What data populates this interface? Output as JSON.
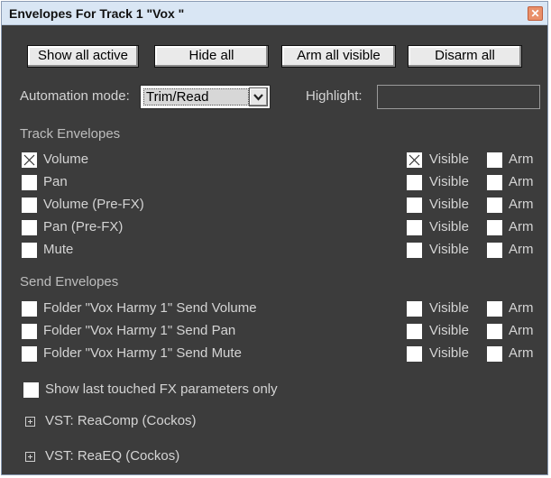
{
  "window": {
    "title": "Envelopes For Track 1 \"Vox \""
  },
  "toolbar": {
    "show_all_active": "Show all active",
    "hide_all": "Hide all",
    "arm_all_visible": "Arm all visible",
    "disarm_all": "Disarm all"
  },
  "automation": {
    "label": "Automation mode:",
    "value": "Trim/Read"
  },
  "highlight": {
    "label": "Highlight:",
    "value": ""
  },
  "visible_label": "Visible",
  "arm_label": "Arm",
  "track_envelopes": {
    "title": "Track Envelopes",
    "rows": [
      {
        "label": "Volume",
        "checked": true,
        "visible": true,
        "arm": false
      },
      {
        "label": "Pan",
        "checked": false,
        "visible": false,
        "arm": false
      },
      {
        "label": "Volume (Pre-FX)",
        "checked": false,
        "visible": false,
        "arm": false
      },
      {
        "label": "Pan (Pre-FX)",
        "checked": false,
        "visible": false,
        "arm": false
      },
      {
        "label": "Mute",
        "checked": false,
        "visible": false,
        "arm": false
      }
    ]
  },
  "send_envelopes": {
    "title": "Send Envelopes",
    "rows": [
      {
        "label": "Folder \"Vox Harmy 1\" Send Volume",
        "checked": false,
        "visible": false,
        "arm": false
      },
      {
        "label": "Folder \"Vox Harmy 1\" Send Pan",
        "checked": false,
        "visible": false,
        "arm": false
      },
      {
        "label": "Folder \"Vox Harmy 1\" Send Mute",
        "checked": false,
        "visible": false,
        "arm": false
      }
    ]
  },
  "show_last_touched": {
    "label": "Show last touched FX parameters only",
    "checked": false
  },
  "fx": [
    {
      "label": "VST: ReaComp (Cockos)"
    },
    {
      "label": "VST: ReaEQ (Cockos)"
    }
  ]
}
